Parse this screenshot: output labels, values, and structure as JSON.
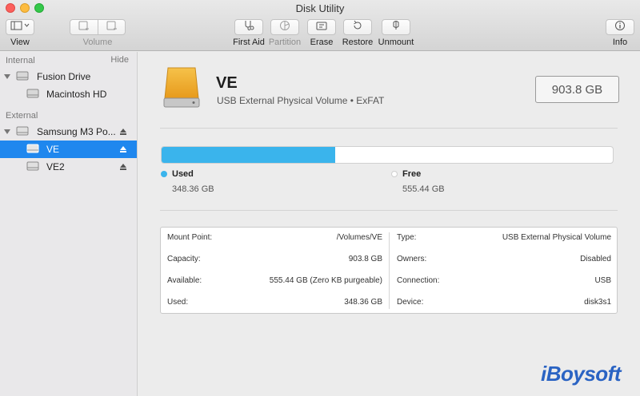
{
  "window": {
    "title": "Disk Utility"
  },
  "toolbar": {
    "view_label": "View",
    "volume_label": "Volume",
    "first_aid_label": "First Aid",
    "partition_label": "Partition",
    "erase_label": "Erase",
    "restore_label": "Restore",
    "unmount_label": "Unmount",
    "info_label": "Info"
  },
  "sidebar": {
    "internal_header": "Internal",
    "hide_label": "Hide",
    "external_header": "External",
    "items": [
      {
        "label": "Fusion Drive"
      },
      {
        "label": "Macintosh HD"
      },
      {
        "label": "Samsung M3 Po..."
      },
      {
        "label": "VE",
        "selected": true
      },
      {
        "label": "VE2"
      }
    ]
  },
  "volume": {
    "name": "VE",
    "description": "USB External Physical Volume • ExFAT",
    "capacity": "903.8 GB"
  },
  "usage": {
    "used_fraction": 0.3855,
    "used_label": "Used",
    "used_value": "348.36 GB",
    "free_label": "Free",
    "free_value": "555.44 GB",
    "used_color": "#3ab4ec",
    "free_color": "#ffffff"
  },
  "details": {
    "left": [
      {
        "key": "Mount Point:",
        "value": "/Volumes/VE"
      },
      {
        "key": "Capacity:",
        "value": "903.8 GB"
      },
      {
        "key": "Available:",
        "value": "555.44 GB (Zero KB purgeable)"
      },
      {
        "key": "Used:",
        "value": "348.36 GB"
      }
    ],
    "right": [
      {
        "key": "Type:",
        "value": "USB External Physical Volume"
      },
      {
        "key": "Owners:",
        "value": "Disabled"
      },
      {
        "key": "Connection:",
        "value": "USB"
      },
      {
        "key": "Device:",
        "value": "disk3s1"
      }
    ]
  },
  "watermark": "iBoysoft",
  "colors": {
    "accent": "#1f87ee",
    "selection": "#1f87ee"
  }
}
